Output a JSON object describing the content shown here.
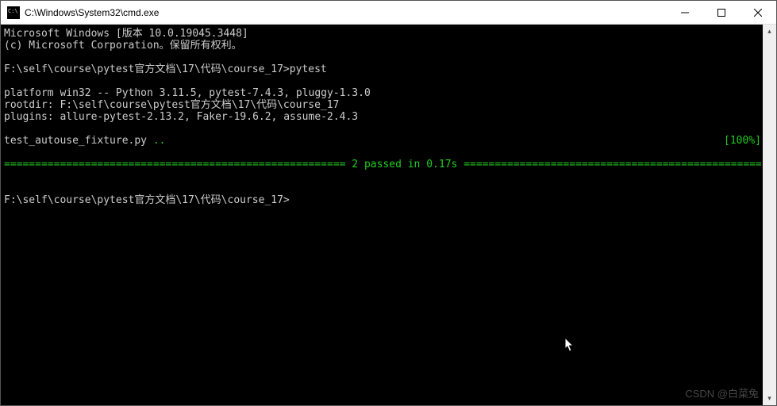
{
  "window": {
    "title": "C:\\Windows\\System32\\cmd.exe"
  },
  "terminal": {
    "line1": "Microsoft Windows [版本 10.0.19045.3448]",
    "line2": "(c) Microsoft Corporation。保留所有权利。",
    "prompt1_path": "F:\\self\\course\\pytest官方文档\\17\\代码\\course_17>",
    "prompt1_cmd": "pytest",
    "platform": "platform win32 -- Python 3.11.5, pytest-7.4.3, pluggy-1.3.0",
    "rootdir": "rootdir: F:\\self\\course\\pytest官方文档\\17\\代码\\course_17",
    "plugins": "plugins: allure-pytest-2.13.2, Faker-19.6.2, assume-2.4.3",
    "test_file": "test_autouse_fixture.py ",
    "test_dots": "..",
    "test_pct": "[100%]",
    "summary_label": " 2 passed in 0.17s ",
    "prompt2": "F:\\self\\course\\pytest官方文档\\17\\代码\\course_17>"
  },
  "watermark": "CSDN @白菜兔"
}
